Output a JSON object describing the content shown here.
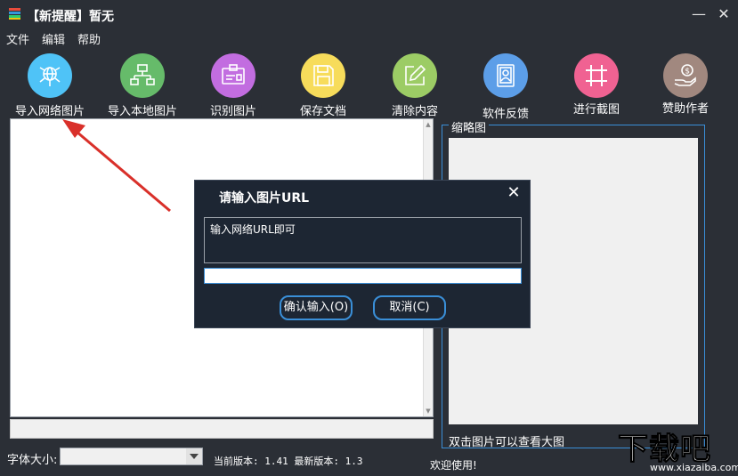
{
  "window": {
    "title": "【新提醒】暂无",
    "minimize_symbol": "—",
    "close_symbol": "✕"
  },
  "menu": [
    "文件",
    "编辑",
    "帮助"
  ],
  "toolbar": [
    {
      "label": "导入网络图片",
      "color": "#4fc3f7",
      "icon": "globe-network-icon"
    },
    {
      "label": "导入本地图片",
      "color": "#66bb6a",
      "icon": "local-network-icon"
    },
    {
      "label": "识别图片",
      "color": "#c26de0",
      "icon": "id-card-icon"
    },
    {
      "label": "保存文档",
      "color": "#f7dc5b",
      "icon": "save-disk-icon"
    },
    {
      "label": "清除内容",
      "color": "#9ccc65",
      "icon": "edit-pencil-icon"
    },
    {
      "label": "软件反馈",
      "color": "#5c9ee8",
      "icon": "contact-card-icon"
    },
    {
      "label": "进行截图",
      "color": "#f06292",
      "icon": "crop-grid-icon"
    },
    {
      "label": "赞助作者",
      "color": "#a1887f",
      "icon": "donate-hand-icon"
    }
  ],
  "thumbnail": {
    "legend": "缩略图",
    "hint": "双击图片可以查看大图"
  },
  "status": {
    "font_size_label": "字体大小:",
    "version_text": "当前版本: 1.41 最新版本: 1.3",
    "welcome": "欢迎使用!"
  },
  "dialog": {
    "title": "请输入图片URL",
    "message": "输入网络URL即可",
    "input_value": "",
    "ok_label": "确认输入(O)",
    "cancel_label": "取消(C)",
    "close_symbol": "✕"
  },
  "watermark": {
    "text": "下载吧",
    "url": "www.xiazaiba.com"
  },
  "colors": {
    "background": "#2b2f36",
    "dialog_bg": "#1d2633",
    "accent": "#3a8fd8",
    "arrow": "#d9302a"
  }
}
